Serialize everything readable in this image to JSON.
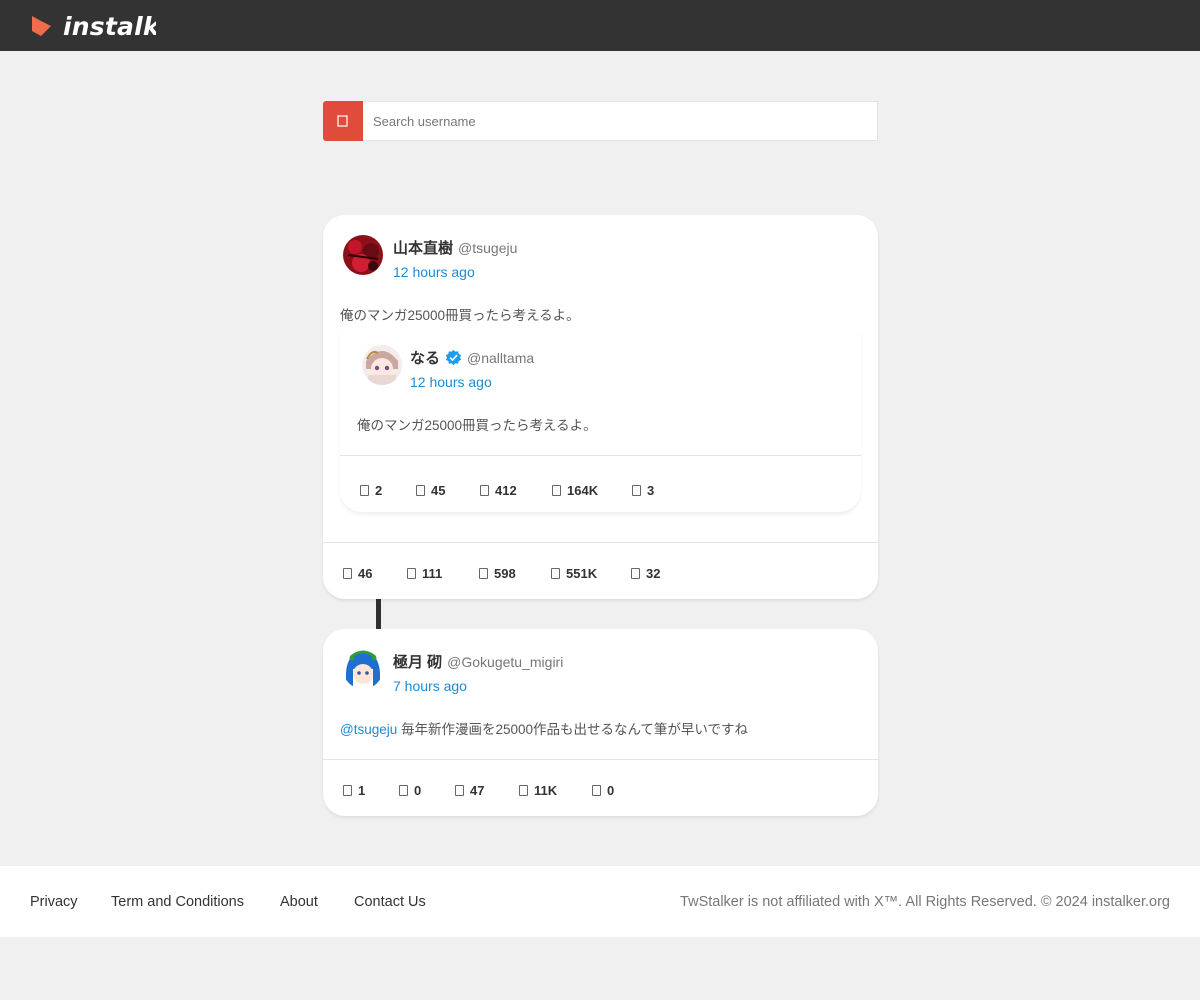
{
  "header": {
    "logo_text": "instalker"
  },
  "search": {
    "placeholder": "Search username",
    "button_icon": "search-icon"
  },
  "tweets": [
    {
      "name": "山本直樹",
      "handle": "@tsugeju",
      "time": "12 hours ago",
      "text": "俺のマンガ25000冊買ったら考えるよ。",
      "quote": {
        "name": "なる",
        "verified": true,
        "handle": "@nalltama",
        "time": "12 hours ago",
        "text": "俺のマンガ25000冊買ったら考えるよ。",
        "stats": {
          "replies": "2",
          "retweets": "45",
          "likes": "412",
          "views": "164K",
          "bookmarks": "3"
        }
      },
      "stats": {
        "replies": "46",
        "retweets": "111",
        "likes": "598",
        "views": "551K",
        "bookmarks": "32"
      }
    },
    {
      "name": "極月 砌",
      "handle": "@Gokugetu_migiri",
      "time": "7 hours ago",
      "mention": "@tsugeju",
      "text": "毎年新作漫画を25000作品も出せるなんて筆が早いですね",
      "stats": {
        "replies": "1",
        "retweets": "0",
        "likes": "47",
        "views": "11K",
        "bookmarks": "0"
      }
    }
  ],
  "footer": {
    "links": [
      "Privacy",
      "Term and Conditions",
      "About",
      "Contact Us"
    ],
    "copyright": "TwStalker is not affiliated with X™. All Rights Reserved. © 2024 instalker.org"
  },
  "colors": {
    "topbar": "#333333",
    "accent": "#e14b3b",
    "link": "#1a8cd8",
    "verified": "#1d9bf0",
    "logo_mark": "#f26b4b"
  }
}
